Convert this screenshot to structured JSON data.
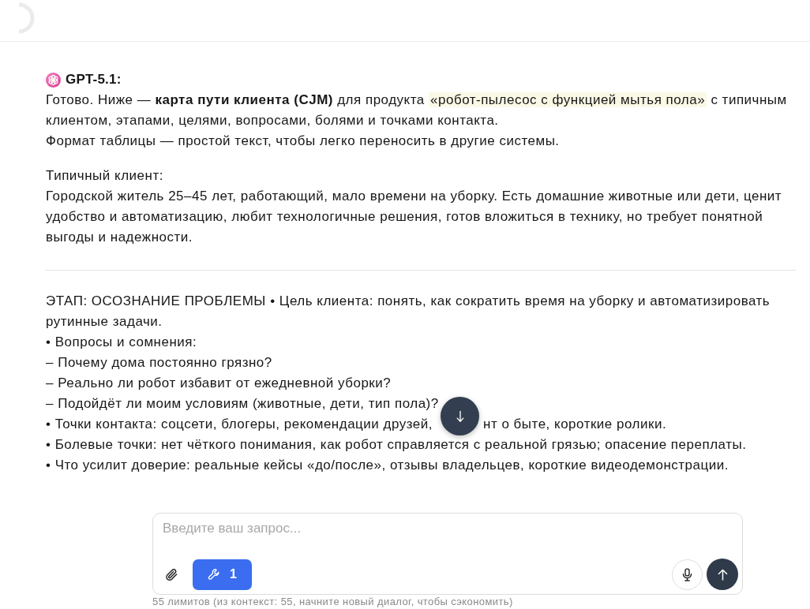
{
  "message": {
    "author": "GPT-5.1:",
    "blocks": [
      {
        "kind": "paragraph",
        "lines": [
          {
            "kind": "text",
            "segments": [
              {
                "kind": "plain",
                "text": "Готово. Ниже — "
              },
              {
                "kind": "strong",
                "text": "карта пути клиента (CJM)"
              },
              {
                "kind": "plain",
                "text": " для продукта "
              },
              {
                "kind": "highlight",
                "text": "«робот-пылесос с функцией мытья пола»"
              },
              {
                "kind": "plain",
                "text": " с типичным клиентом, этапами, целями, вопросами, болями и точками контакта."
              }
            ]
          },
          {
            "kind": "text",
            "segments": [
              {
                "kind": "plain",
                "text": "Формат таблицы — простой текст, чтобы легко переносить в другие системы."
              }
            ]
          }
        ]
      },
      {
        "kind": "paragraph",
        "lines": [
          {
            "kind": "text",
            "segments": [
              {
                "kind": "plain",
                "text": "Типичный клиент:"
              }
            ]
          },
          {
            "kind": "text",
            "segments": [
              {
                "kind": "plain",
                "text": "Городской житель 25–45 лет, работающий, мало времени на уборку. Есть домашние животные или дети, ценит удобство и автоматизацию, любит технологичные решения, готов вложиться в технику, но требует понятной выгоды и надежности."
              }
            ]
          }
        ]
      },
      {
        "kind": "divider"
      },
      {
        "kind": "paragraph",
        "lines": [
          {
            "kind": "text",
            "segments": [
              {
                "kind": "plain",
                "text": "ЭТАП: ОСОЗНАНИЕ ПРОБЛЕМЫ • Цель клиента: понять, как сократить время на уборку и автоматизировать рутинные задачи."
              }
            ]
          },
          {
            "kind": "text",
            "segments": [
              {
                "kind": "plain",
                "text": "• Вопросы и сомнения:"
              }
            ]
          },
          {
            "kind": "text",
            "segments": [
              {
                "kind": "plain",
                "text": "– Почему дома постоянно грязно?"
              }
            ]
          },
          {
            "kind": "text",
            "segments": [
              {
                "kind": "plain",
                "text": "– Реально ли робот избавит от ежедневной уборки?"
              }
            ]
          },
          {
            "kind": "text",
            "segments": [
              {
                "kind": "plain",
                "text": "– Подойдёт ли моим условиям (животные, дети, тип пола)?"
              }
            ]
          },
          {
            "kind": "covered",
            "before": "• Точки контакта: соцсети, блогеры, рекомендации друзей,",
            "after": "нт о быте, короткие ролики."
          },
          {
            "kind": "text",
            "segments": [
              {
                "kind": "plain",
                "text": "• Болевые точки: нет чёткого понимания, как робот справляется с реальной грязью; опасение переплаты."
              }
            ]
          },
          {
            "kind": "text",
            "segments": [
              {
                "kind": "plain",
                "text": "• Что усилит доверие: реальные кейсы «до/после», отзывы владельцев, короткие видеодемонстрации."
              }
            ]
          }
        ]
      }
    ]
  },
  "composer": {
    "placeholder": "Введите ваш запрос...",
    "tools_count": "1",
    "note": "55 лимитов (из контекст: 55, начните новый диалог, чтобы сэкономить)"
  }
}
